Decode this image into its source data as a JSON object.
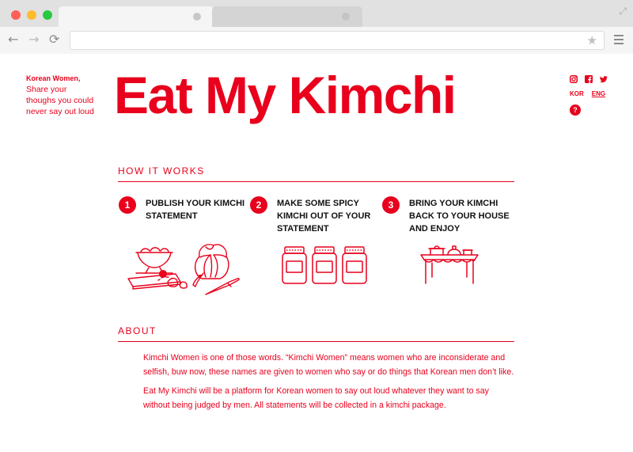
{
  "browser": {
    "star_glyph": "★",
    "back_glyph": "←",
    "forward_glyph": "→",
    "reload_glyph": "⟳",
    "fullscreen_glyph": "⤢"
  },
  "tagline": {
    "heading": "Korean Women,",
    "text": "Share your thoughs you could never say out loud"
  },
  "site_title": "Eat My Kimchi",
  "social": {
    "icons": [
      "instagram-icon",
      "facebook-icon",
      "twitter-icon"
    ]
  },
  "lang": {
    "kor": "KOR",
    "eng": "ENG"
  },
  "help_label": "?",
  "how_it_works": {
    "heading": "HOW IT WORKS",
    "steps": [
      {
        "number": "1",
        "text": "PUBLISH YOUR KIMCHI STATEMENT"
      },
      {
        "number": "2",
        "text": "MAKE SOME SPICY KIMCHI OUT OF YOUR STATEMENT"
      },
      {
        "number": "3",
        "text": "BRING YOUR KIMCHI BACK TO YOUR HOUSE AND ENJOY"
      }
    ]
  },
  "about": {
    "heading": "ABOUT",
    "paragraphs": [
      "Kimchi Women is one of those words. “Kimchi Women” means women who are inconsiderate and selfish, buw now, these names are given to women who say or do things that Korean men don’t like.",
      "Eat My Kimchi will be a platform for Korean women to say out loud whatever they want to say without being judged by men. All statements will be collected in a kimchi package."
    ]
  },
  "colors": {
    "accent": "#e8001c",
    "step_text": "#111111",
    "chrome": "#e1e1e1"
  }
}
